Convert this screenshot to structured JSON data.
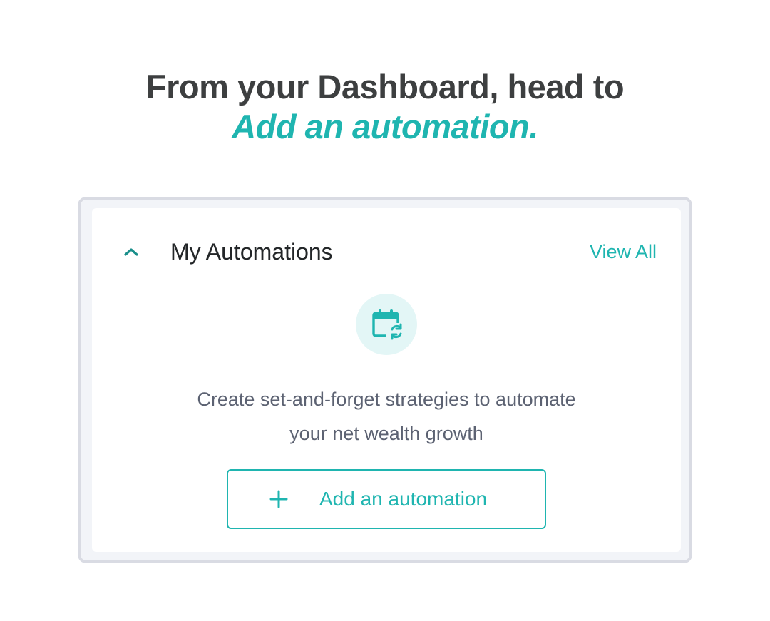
{
  "heading": {
    "line1": "From your Dashboard, head to",
    "line2": "Add an automation."
  },
  "card": {
    "title": "My Automations",
    "view_all_label": "View All",
    "collapse_icon": "chevron-up-icon",
    "feature_icon": "calendar-sync-icon",
    "description_line1": "Create set-and-forget strategies to automate",
    "description_line2": "your net wealth growth",
    "add_button_label": "Add an automation",
    "add_button_icon": "plus-icon"
  },
  "colors": {
    "accent": "#1fb5b0",
    "heading_text": "#3d3f40",
    "body_text": "#5c6272",
    "icon_bg": "#e3f6f6",
    "frame_border": "#d9dbe3"
  }
}
